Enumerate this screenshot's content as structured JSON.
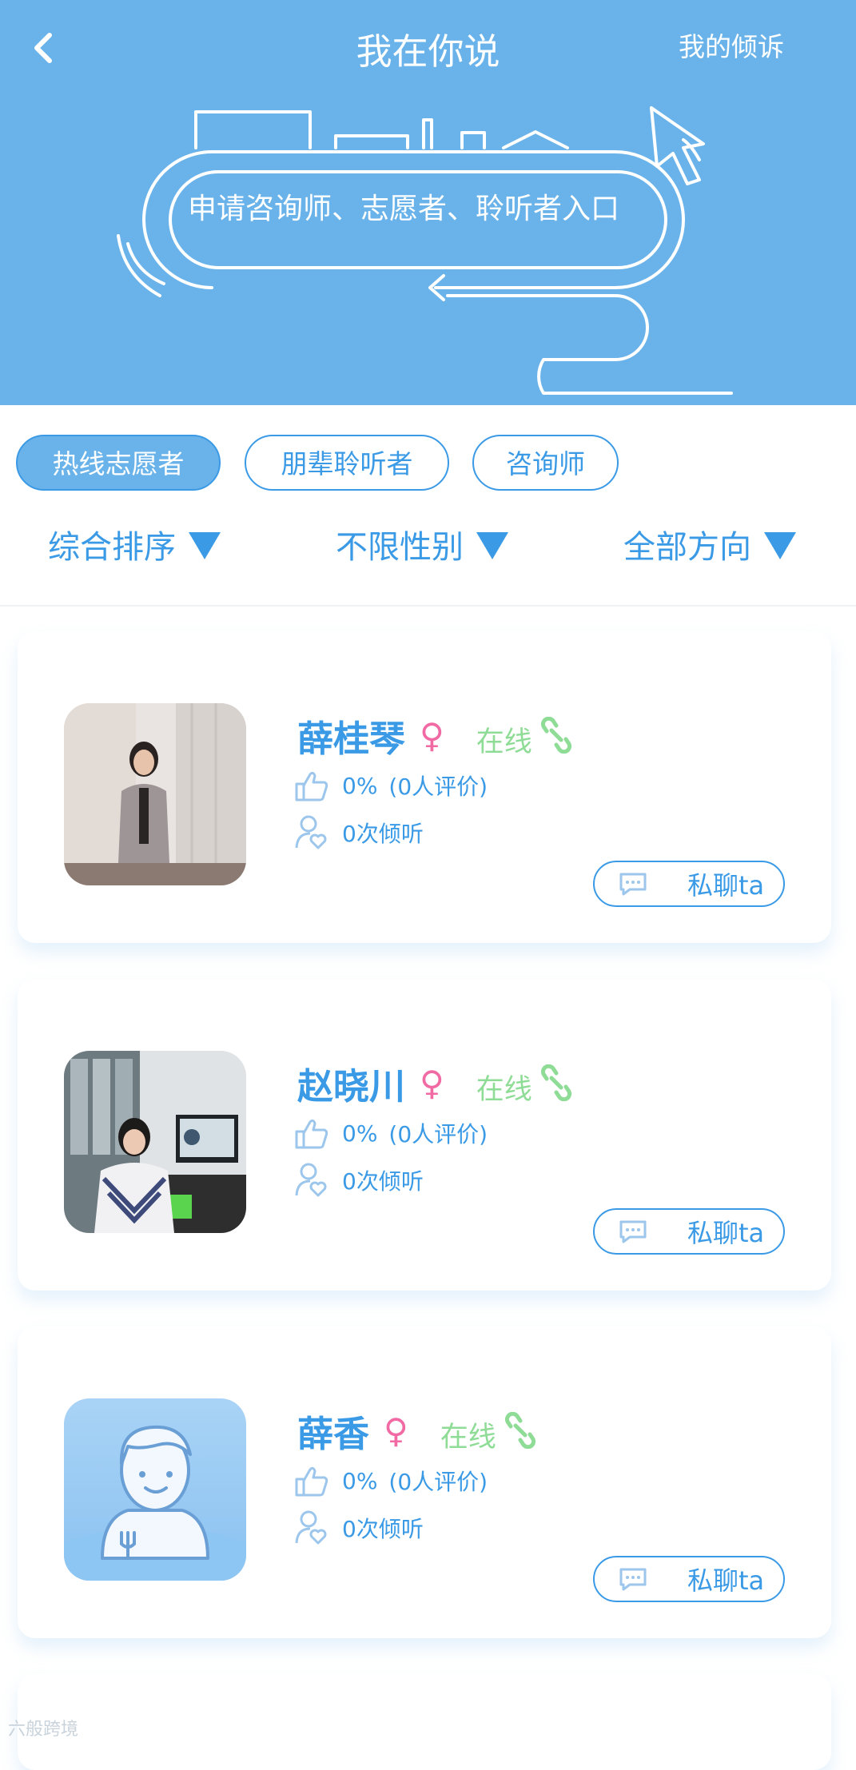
{
  "header": {
    "title": "我在你说",
    "right_link": "我的倾诉",
    "entry_text": "申请咨询师、志愿者、聆听者入口"
  },
  "tabs": [
    {
      "label": "热线志愿者",
      "active": true
    },
    {
      "label": "朋辈聆听者",
      "active": false
    },
    {
      "label": "咨询师",
      "active": false
    }
  ],
  "filters": [
    {
      "label": "综合排序"
    },
    {
      "label": "不限性别"
    },
    {
      "label": "全部方向"
    }
  ],
  "counselors": [
    {
      "name": "薛桂琴",
      "gender_symbol": "♀",
      "status": "在线",
      "rating": "0%",
      "reviews": "(0人评价)",
      "listens": "0次倾听",
      "chat_label": "私聊ta"
    },
    {
      "name": "赵晓川",
      "gender_symbol": "♀",
      "status": "在线",
      "rating": "0%",
      "reviews": "(0人评价)",
      "listens": "0次倾听",
      "chat_label": "私聊ta"
    },
    {
      "name": "薛香",
      "gender_symbol": "♀",
      "status": "在线",
      "rating": "0%",
      "reviews": "(0人评价)",
      "listens": "0次倾听",
      "chat_label": "私聊ta"
    }
  ],
  "watermark": "六般跨境",
  "colors": {
    "header_bg": "#6ab3ea",
    "accent": "#3a9ae6",
    "female": "#f16aa4",
    "online": "#8fdc97"
  }
}
